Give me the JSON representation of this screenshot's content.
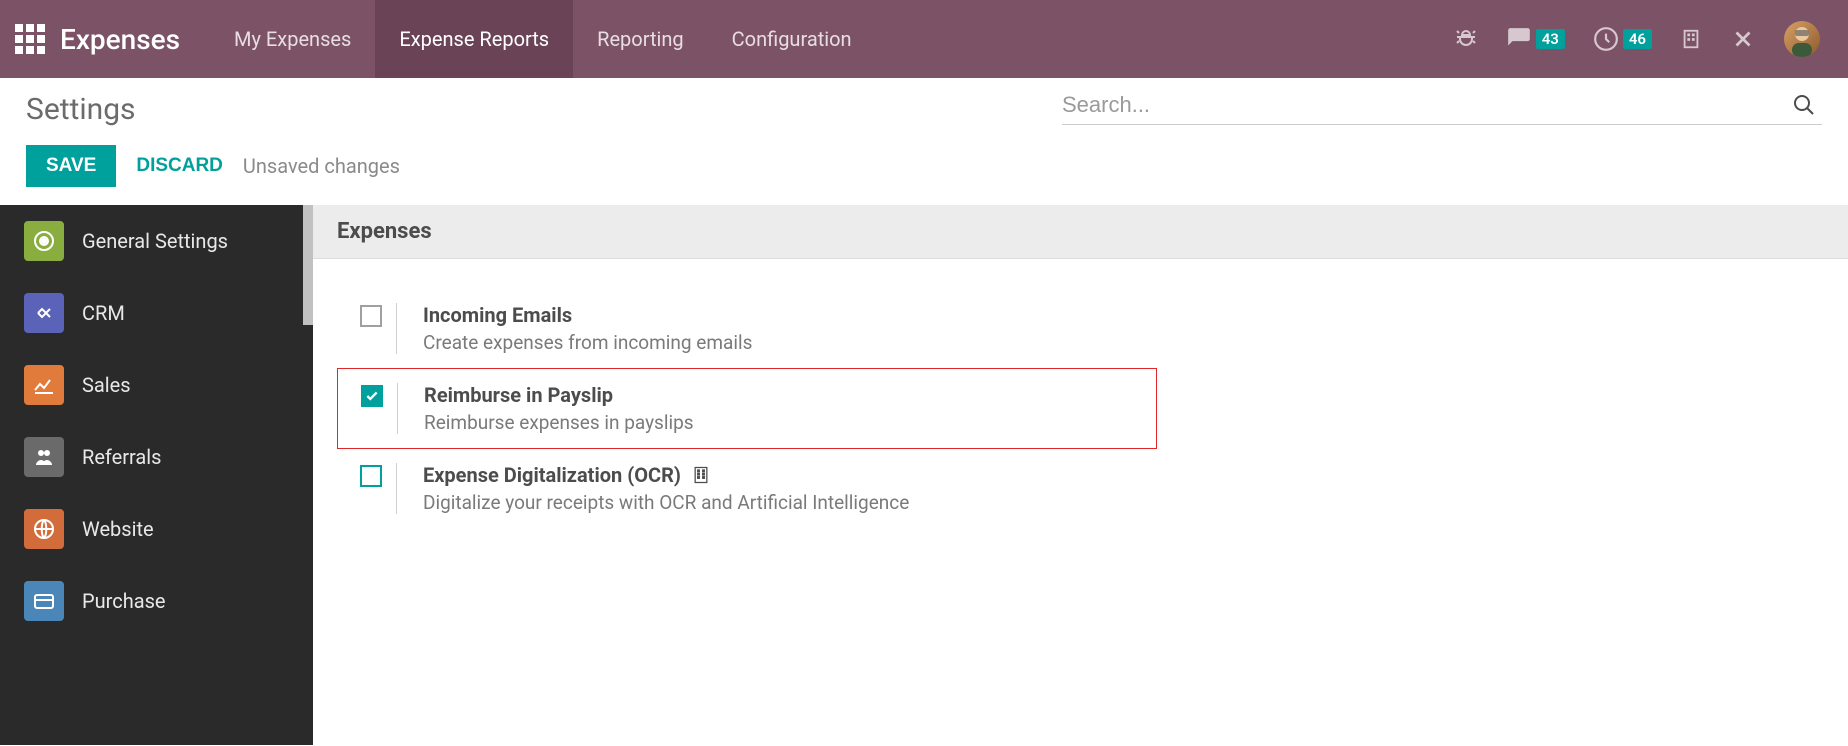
{
  "brand": "Expenses",
  "topnav": {
    "items": [
      "My Expenses",
      "Expense Reports",
      "Reporting",
      "Configuration"
    ],
    "active_index": 1
  },
  "systray": {
    "messages_badge": "43",
    "activities_badge": "46"
  },
  "breadcrumb": {
    "title": "Settings"
  },
  "buttons": {
    "save": "SAVE",
    "discard": "DISCARD"
  },
  "status": {
    "unsaved": "Unsaved changes"
  },
  "search": {
    "placeholder": "Search..."
  },
  "sidebar": {
    "items": [
      {
        "label": "General Settings",
        "bg": "#8aad3f"
      },
      {
        "label": "CRM",
        "bg": "#5b63b8"
      },
      {
        "label": "Sales",
        "bg": "#e07b3c"
      },
      {
        "label": "Referrals",
        "bg": "#6a6a6a"
      },
      {
        "label": "Website",
        "bg": "#d36c3b"
      },
      {
        "label": "Purchase",
        "bg": "#4a87b8"
      }
    ]
  },
  "section": {
    "title": "Expenses"
  },
  "settings": [
    {
      "title": "Incoming Emails",
      "desc": "Create expenses from incoming emails",
      "checked": false,
      "outline": false,
      "highlight": false,
      "enterprise": false
    },
    {
      "title": "Reimburse in Payslip",
      "desc": "Reimburse expenses in payslips",
      "checked": true,
      "outline": false,
      "highlight": true,
      "enterprise": false
    },
    {
      "title": "Expense Digitalization (OCR)",
      "desc": "Digitalize your receipts with OCR and Artificial Intelligence",
      "checked": false,
      "outline": true,
      "highlight": false,
      "enterprise": true
    }
  ]
}
